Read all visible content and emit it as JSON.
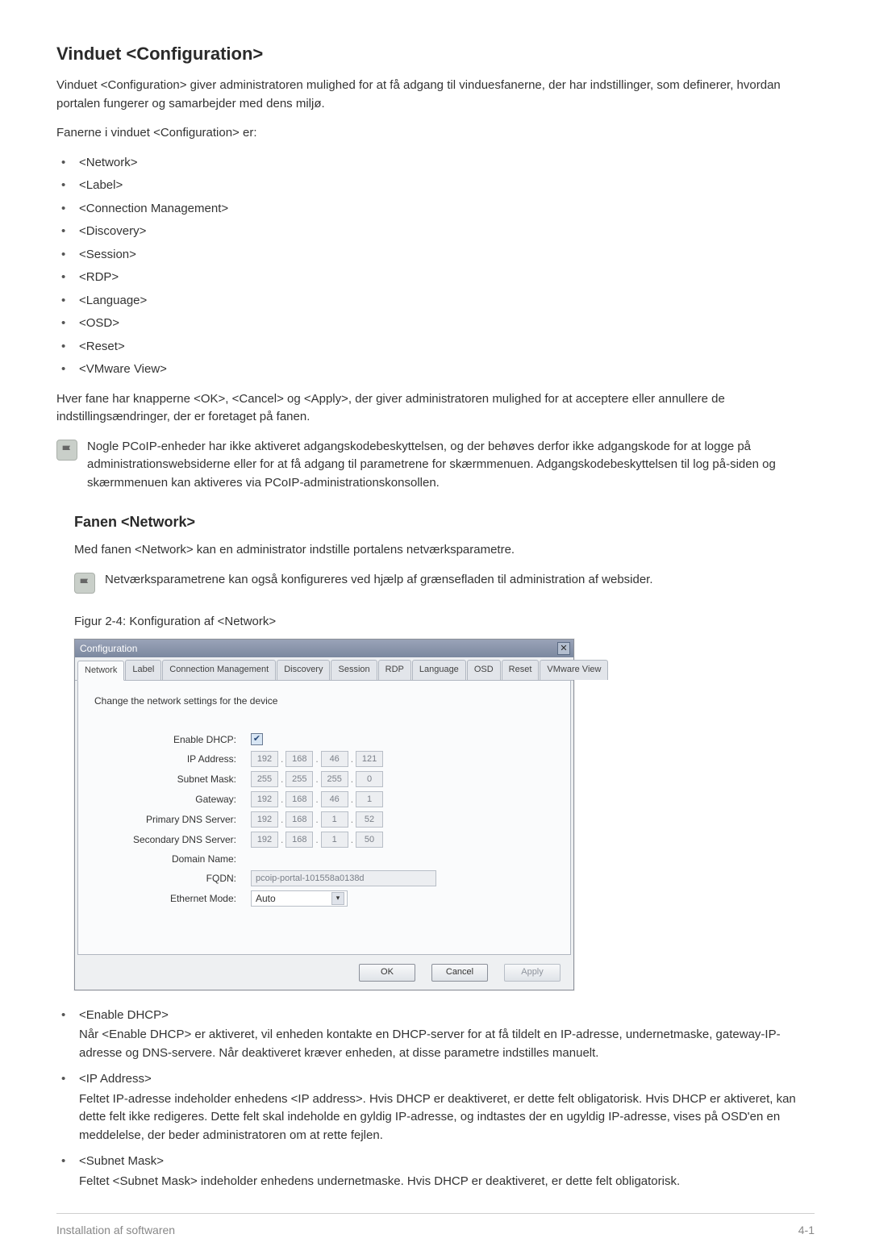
{
  "title": "Vinduet <Configuration>",
  "intro": "Vinduet <Configuration> giver administratoren mulighed for at få adgang til vinduesfanerne, der har indstillinger, som definerer, hvordan portalen fungerer og samarbejder med dens miljø.",
  "tabs_intro": "Fanerne i vinduet <Configuration> er:",
  "tabs_list": [
    "<Network>",
    "<Label>",
    "<Connection Management>",
    "<Discovery>",
    "<Session>",
    "<RDP>",
    "<Language>",
    "<OSD>",
    "<Reset>",
    "<VMware View>"
  ],
  "after_list": "Hver fane har knapperne <OK>, <Cancel> og <Apply>, der giver administratoren mulighed for at acceptere eller annullere de indstillingsændringer, der er foretaget på fanen.",
  "note1": "Nogle PCoIP-enheder har ikke aktiveret adgangskodebeskyttelsen, og der behøves derfor ikke adgangskode for at logge på administrationswebsiderne eller for at få adgang til parametrene for skærmmenuen. Adgangskodebeskyttelsen til log på-siden og skærmmenuen kan aktiveres via PCoIP-administrationskonsollen.",
  "section2_title": "Fanen <Network>",
  "section2_para": "Med fanen <Network> kan en administrator indstille portalens netværksparametre.",
  "note2": "Netværksparametrene kan også konfigureres ved hjælp af grænsefladen til administration af websider.",
  "figure_caption": "Figur 2-4: Konfiguration af <Network>",
  "dialog": {
    "title": "Configuration",
    "tabs": [
      "Network",
      "Label",
      "Connection Management",
      "Discovery",
      "Session",
      "RDP",
      "Language",
      "OSD",
      "Reset",
      "VMware View"
    ],
    "active_tab": 0,
    "panel_desc": "Change the network settings for the device",
    "labels": {
      "enable_dhcp": "Enable DHCP:",
      "ip_address": "IP Address:",
      "subnet_mask": "Subnet Mask:",
      "gateway": "Gateway:",
      "primary_dns": "Primary DNS Server:",
      "secondary_dns": "Secondary DNS Server:",
      "domain_name": "Domain Name:",
      "fqdn": "FQDN:",
      "ethernet_mode": "Ethernet Mode:"
    },
    "values": {
      "enable_dhcp": true,
      "ip_address": [
        "192",
        "168",
        "46",
        "121"
      ],
      "subnet_mask": [
        "255",
        "255",
        "255",
        "0"
      ],
      "gateway": [
        "192",
        "168",
        "46",
        "1"
      ],
      "primary_dns": [
        "192",
        "168",
        "1",
        "52"
      ],
      "secondary_dns": [
        "192",
        "168",
        "1",
        "50"
      ],
      "domain_name": "",
      "fqdn": "pcoip-portal-101558a0138d",
      "ethernet_mode": "Auto"
    },
    "buttons": {
      "ok": "OK",
      "cancel": "Cancel",
      "apply": "Apply"
    }
  },
  "definitions": [
    {
      "term": "<Enable DHCP>",
      "def": "Når <Enable DHCP> er aktiveret, vil enheden kontakte en DHCP-server for at få tildelt en IP-adresse, undernetmaske, gateway-IP-adresse og DNS-servere. Når deaktiveret kræver enheden, at disse parametre indstilles manuelt."
    },
    {
      "term": "<IP Address>",
      "def": "Feltet IP-adresse indeholder enhedens <IP address>. Hvis DHCP er deaktiveret, er dette felt obligatorisk. Hvis DHCP er aktiveret, kan dette felt ikke redigeres. Dette felt skal indeholde en gyldig IP-adresse, og indtastes der en ugyldig IP-adresse, vises på OSD'en en meddelelse, der beder administratoren om at rette fejlen."
    },
    {
      "term": "<Subnet Mask>",
      "def": "Feltet <Subnet Mask> indeholder enhedens undernetmaske. Hvis DHCP er deaktiveret, er dette felt obligatorisk."
    }
  ],
  "footer": {
    "left": "Installation af softwaren",
    "right": "4-1"
  }
}
